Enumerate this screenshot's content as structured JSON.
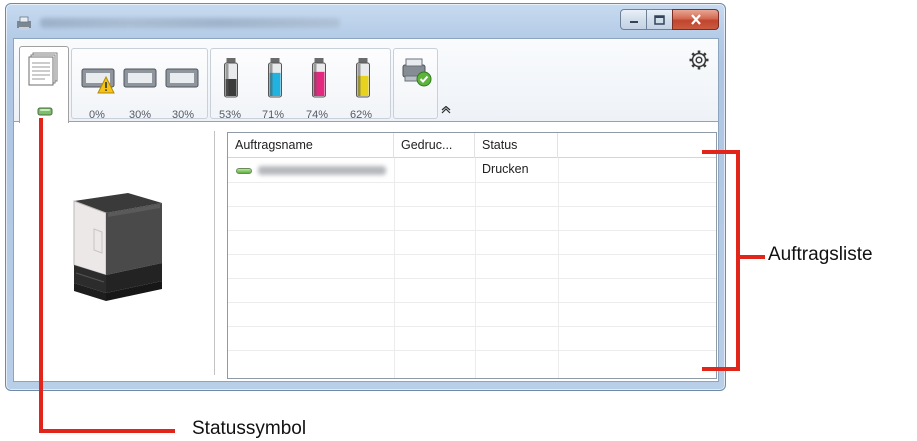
{
  "window": {
    "title": "",
    "caption_buttons": [
      "minimize",
      "maximize",
      "close"
    ]
  },
  "toolbar": {
    "paper_levels": [
      "0%",
      "30%",
      "30%"
    ],
    "toner_levels": [
      {
        "label": "53%",
        "color": "#3b3b3b",
        "fraction": 0.53
      },
      {
        "label": "71%",
        "color": "#22b2e0",
        "fraction": 0.71
      },
      {
        "label": "74%",
        "color": "#e2287f",
        "fraction": 0.74
      },
      {
        "label": "62%",
        "color": "#e6d21f",
        "fraction": 0.62
      }
    ],
    "icons": [
      "job-list-icon",
      "status-led-icon",
      "paper-tray-warning-icon",
      "paper-tray-icon",
      "paper-tray-icon",
      "toner-black-icon",
      "toner-cyan-icon",
      "toner-magenta-icon",
      "toner-yellow-icon",
      "device-ok-icon",
      "collapse-icon",
      "gear-icon"
    ]
  },
  "joblist": {
    "columns": [
      "Auftragsname",
      "Gedruc...",
      "Status"
    ],
    "rows": [
      {
        "name": "",
        "printed": "",
        "status": "Drucken"
      }
    ]
  },
  "callouts": {
    "joblist_label": "Auftragsliste",
    "status_label": "Statussymbol",
    "color": "#e1251b"
  }
}
